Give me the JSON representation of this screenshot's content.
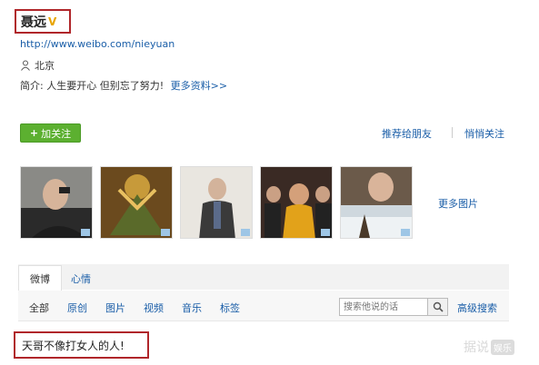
{
  "profile": {
    "name": "聂远",
    "verified_mark": "V",
    "url": "http://www.weibo.com/nieyuan",
    "location": "北京",
    "intro_label": "简介:",
    "intro_text": "人生要开心 但别忘了努力!",
    "more_info": "更多资料>>"
  },
  "actions": {
    "follow_label": "加关注",
    "recommend_label": "推荐给朋友",
    "quiet_follow_label": "悄悄关注"
  },
  "photos": {
    "more_label": "更多图片"
  },
  "tabs": [
    {
      "label": "微博"
    },
    {
      "label": "心情"
    }
  ],
  "filters": [
    {
      "label": "全部"
    },
    {
      "label": "原创"
    },
    {
      "label": "图片"
    },
    {
      "label": "视频"
    },
    {
      "label": "音乐"
    },
    {
      "label": "标签"
    }
  ],
  "search": {
    "placeholder": "搜索他说的话",
    "advanced_label": "高级搜索"
  },
  "post": {
    "text": "天哥不像打女人的人!"
  },
  "watermark": {
    "text": "据说",
    "badge": "娱乐"
  },
  "colors": {
    "highlight_border": "#b0262a",
    "link": "#1a5ea8",
    "follow_green": "#5cb030",
    "verified": "#e8a400"
  }
}
